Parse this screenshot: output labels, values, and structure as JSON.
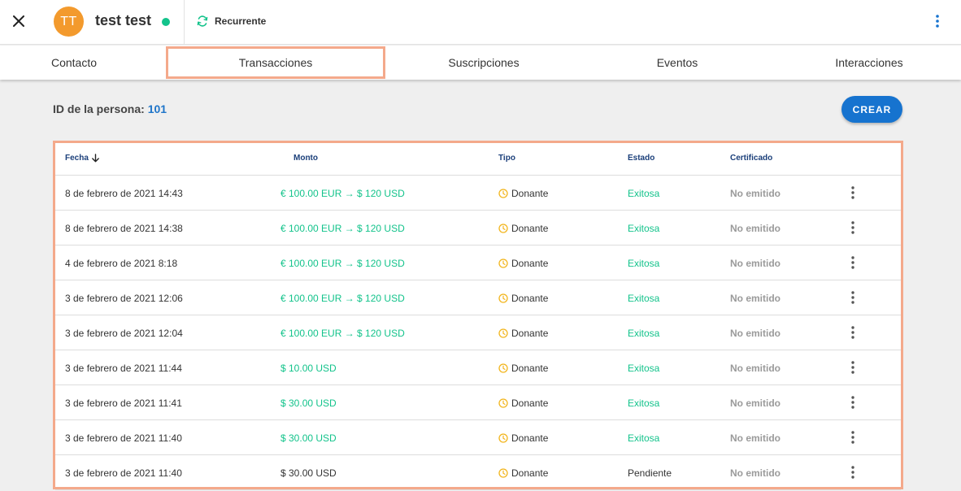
{
  "header": {
    "close_label": "×",
    "avatar_initials": "TT",
    "person_name": "test test",
    "recurrent_label": "Recurrente",
    "colors": {
      "avatar": "#f39a2d",
      "online": "#13c38b",
      "accent": "#1673cf"
    }
  },
  "tabs": [
    {
      "label": "Contacto"
    },
    {
      "label": "Transacciones"
    },
    {
      "label": "Suscripciones"
    },
    {
      "label": "Eventos"
    },
    {
      "label": "Interacciones"
    }
  ],
  "person": {
    "id_label": "ID de la persona:",
    "id_value": "101"
  },
  "create_button": "CREAR",
  "table": {
    "headers": {
      "fecha": "Fecha",
      "monto": "Monto",
      "tipo": "Tipo",
      "estado": "Estado",
      "certificado": "Certificado"
    },
    "rows": [
      {
        "fecha": "8 de febrero de 2021 14:43",
        "monto": "€ 100.00 EUR → $ 120 USD",
        "tipo": "Donante",
        "estado": "Exitosa",
        "certificado": "No emitido"
      },
      {
        "fecha": "8 de febrero de 2021 14:38",
        "monto": "€ 100.00 EUR → $ 120 USD",
        "tipo": "Donante",
        "estado": "Exitosa",
        "certificado": "No emitido"
      },
      {
        "fecha": "4 de febrero de 2021 8:18",
        "monto": "€ 100.00 EUR → $ 120 USD",
        "tipo": "Donante",
        "estado": "Exitosa",
        "certificado": "No emitido"
      },
      {
        "fecha": "3 de febrero de 2021 12:06",
        "monto": "€ 100.00 EUR → $ 120 USD",
        "tipo": "Donante",
        "estado": "Exitosa",
        "certificado": "No emitido"
      },
      {
        "fecha": "3 de febrero de 2021 12:04",
        "monto": "€ 100.00 EUR → $ 120 USD",
        "tipo": "Donante",
        "estado": "Exitosa",
        "certificado": "No emitido"
      },
      {
        "fecha": "3 de febrero de 2021 11:44",
        "monto": "$ 10.00 USD",
        "tipo": "Donante",
        "estado": "Exitosa",
        "certificado": "No emitido"
      },
      {
        "fecha": "3 de febrero de 2021 11:41",
        "monto": "$ 30.00 USD",
        "tipo": "Donante",
        "estado": "Exitosa",
        "certificado": "No emitido"
      },
      {
        "fecha": "3 de febrero de 2021 11:40",
        "monto": "$ 30.00 USD",
        "tipo": "Donante",
        "estado": "Exitosa",
        "certificado": "No emitido"
      },
      {
        "fecha": "3 de febrero de 2021 11:40",
        "monto": "$ 30.00 USD",
        "tipo": "Donante",
        "estado": "Pendiente",
        "certificado": "No emitido"
      }
    ]
  }
}
